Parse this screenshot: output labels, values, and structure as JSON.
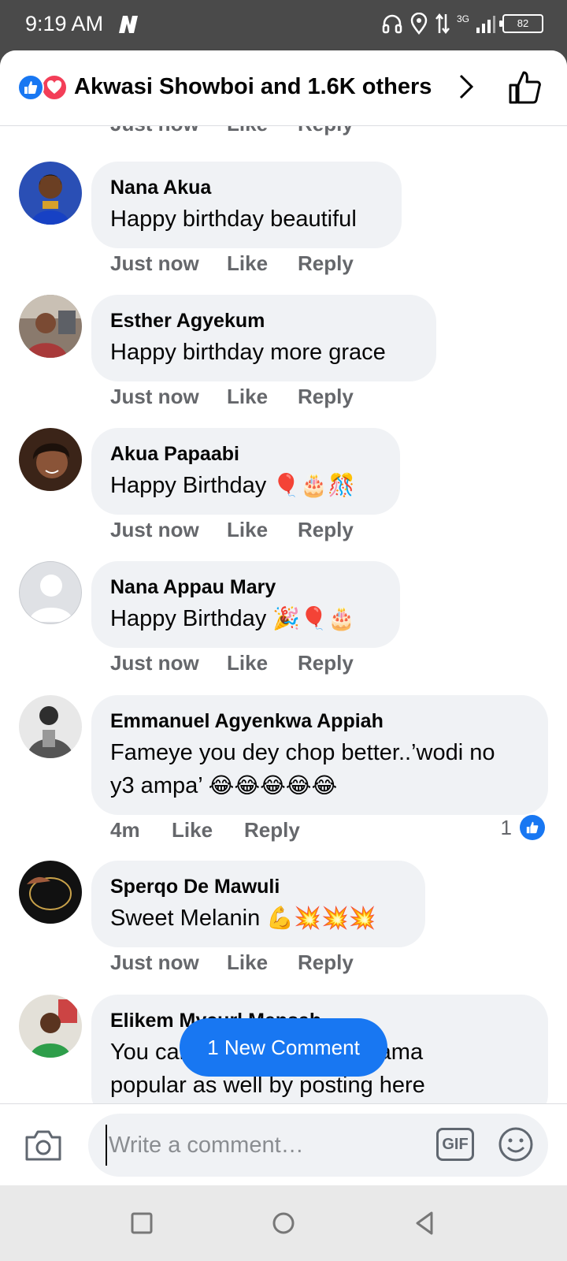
{
  "status": {
    "time": "9:19 AM",
    "network": "3G",
    "battery": "82"
  },
  "header": {
    "title": "Akwasi Showboi and 1.6K others"
  },
  "top_partial": {
    "time": "Just now",
    "like": "Like",
    "reply": "Reply"
  },
  "comments": [
    {
      "name": "Nana Akua",
      "text": "Happy birthday beautiful",
      "emoji": "",
      "time": "Just now",
      "like": "Like",
      "reply": "Reply"
    },
    {
      "name": "Esther Agyekum",
      "text": "Happy birthday more grace",
      "emoji": "",
      "time": "Just now",
      "like": "Like",
      "reply": "Reply"
    },
    {
      "name": "Akua Papaabi",
      "text": "Happy Birthday ",
      "emoji": "🎈🎂🎊",
      "time": "Just now",
      "like": "Like",
      "reply": "Reply"
    },
    {
      "name": "Nana Appau Mary",
      "text": "Happy Birthday ",
      "emoji": "🎉🎈🎂",
      "time": "Just now",
      "like": "Like",
      "reply": "Reply"
    },
    {
      "name": "Emmanuel Agyenkwa Appiah",
      "text": "Fameye you dey chop better..’wodi no",
      "text2": "y3 ampa’ ",
      "emoji": "😂😂😂😂😂",
      "time": "4m",
      "like": "Like",
      "reply": "Reply",
      "reaction_count": "1"
    },
    {
      "name": "Sperqo De Mawuli",
      "text": "Sweet Melanin ",
      "emoji": "💪💥💥💥",
      "time": "Just now",
      "like": "Like",
      "reply": "Reply"
    },
    {
      "name": "Elikem Mycurl Mensah",
      "text": "You can also make your mama",
      "text2": "popular as well by posting here"
    }
  ],
  "new_comment_pill": "1 New Comment",
  "composer": {
    "placeholder": "Write a comment…",
    "gif": "GIF"
  },
  "colors": {
    "accent": "#1877f2",
    "love": "#f33e58",
    "bubble": "#f0f2f5",
    "meta": "#65676b"
  }
}
